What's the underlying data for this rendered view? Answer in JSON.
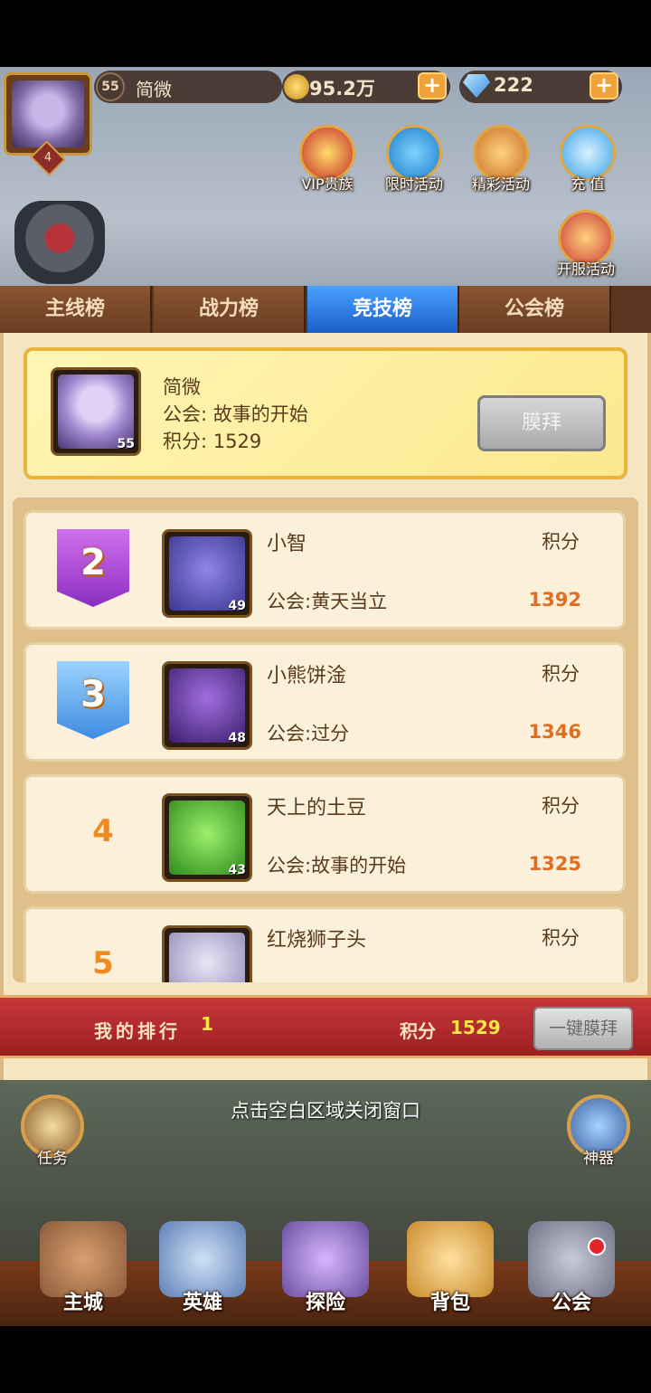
{
  "header": {
    "player_level": "55",
    "player_name": "简微",
    "gold": "95.2万",
    "gems": "222",
    "vip_level": "4",
    "menu": [
      {
        "label": "VIP贵族",
        "icon": "crown-icon",
        "color": "#c42b2b"
      },
      {
        "label": "限时活动",
        "icon": "clock-compass-icon",
        "color": "#1b7fc9"
      },
      {
        "label": "精彩活动",
        "icon": "ring-trophy-icon",
        "color": "#c9702b"
      },
      {
        "label": "充 值",
        "icon": "diamond-icon",
        "color": "#3aa0e6"
      },
      {
        "label": "开服活动",
        "icon": "treasure-icon",
        "color": "#c93a3a"
      }
    ]
  },
  "tabs": [
    {
      "label": "主线榜",
      "active": false
    },
    {
      "label": "战力榜",
      "active": false
    },
    {
      "label": "竞技榜",
      "active": true
    },
    {
      "label": "公会榜",
      "active": false
    }
  ],
  "me": {
    "name": "简微",
    "guild": "公会: 故事的开始",
    "score": "积分: 1529",
    "level": "55",
    "worship_label": "膜拜"
  },
  "ranking": [
    {
      "rank": "2",
      "style": "purple",
      "name": "小智",
      "guild": "公会:黄天当立",
      "points_label": "积分",
      "points": "1392",
      "level": "49",
      "color": "#5a4fb8"
    },
    {
      "rank": "3",
      "style": "blue",
      "name": "小熊饼淦",
      "guild": "公会:过分",
      "points_label": "积分",
      "points": "1346",
      "level": "48",
      "color": "#6b3fa8"
    },
    {
      "rank": "4",
      "style": "plain",
      "name": "天上的土豆",
      "guild": "公会:故事的开始",
      "points_label": "积分",
      "points": "1325",
      "level": "43",
      "color": "#5ec63a"
    },
    {
      "rank": "5",
      "style": "plain",
      "name": "红烧狮子头",
      "guild": "",
      "points_label": "积分",
      "points": "",
      "level": "",
      "color": "#b9b6d6"
    }
  ],
  "my_rank": {
    "label": "我的排行",
    "rank": "1",
    "points_label": "积分",
    "points": "1529",
    "worship_all_label": "一键膜拜"
  },
  "close_hint": "点击空白区域关闭窗口",
  "side": {
    "left": {
      "label": "任务",
      "icon": "scroll-icon"
    },
    "right": {
      "label": "神器",
      "icon": "dragon-icon"
    }
  },
  "nav": [
    {
      "label": "主城",
      "icon": "castle-icon",
      "color": "#8b5a3a"
    },
    {
      "label": "英雄",
      "icon": "hero-icon",
      "color": "#5e7fb6"
    },
    {
      "label": "探险",
      "icon": "portal-icon",
      "color": "#6a4e9e"
    },
    {
      "label": "背包",
      "icon": "backpack-icon",
      "color": "#c98b2b"
    },
    {
      "label": "公会",
      "icon": "guild-tower-icon",
      "color": "#6f7386"
    }
  ]
}
